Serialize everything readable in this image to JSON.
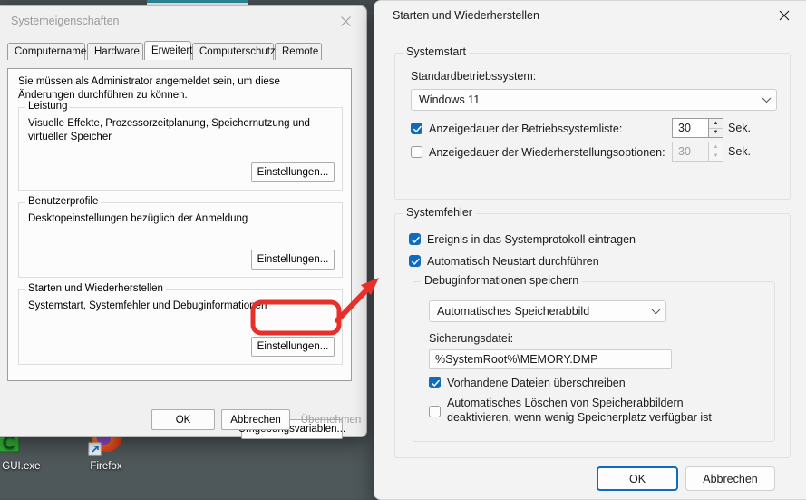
{
  "desktop": {
    "icons": [
      {
        "name": "te GUI.exe",
        "label": "te GUI.exe"
      },
      {
        "name": "firefox",
        "label": "Firefox"
      }
    ]
  },
  "sysprops": {
    "title": "Systemeigenschaften",
    "close_icon": "close-icon",
    "tabs": [
      {
        "label": "Computername",
        "active": false
      },
      {
        "label": "Hardware",
        "active": false
      },
      {
        "label": "Erweitert",
        "active": true
      },
      {
        "label": "Computerschutz",
        "active": false
      },
      {
        "label": "Remote",
        "active": false
      }
    ],
    "intro": "Sie müssen als Administrator angemeldet sein, um diese Änderungen durchführen zu können.",
    "groups": [
      {
        "legend": "Leistung",
        "text": "Visuelle Effekte, Prozessorzeitplanung, Speichernutzung und virtueller Speicher",
        "button": "Einstellungen..."
      },
      {
        "legend": "Benutzerprofile",
        "text": "Desktopeinstellungen bezüglich der Anmeldung",
        "button": "Einstellungen..."
      },
      {
        "legend": "Starten und Wiederherstellen",
        "text": "Systemstart, Systemfehler und Debuginformationen",
        "button": "Einstellungen..."
      }
    ],
    "env_button": "Umgebungsvariablen...",
    "footer": {
      "ok": "OK",
      "cancel": "Abbrechen",
      "apply": "Übernehmen"
    }
  },
  "startrec": {
    "title": "Starten und Wiederherstellen",
    "close_icon": "close-icon",
    "systemstart": {
      "legend": "Systemstart",
      "default_os_label": "Standardbetriebssystem:",
      "default_os_value": "Windows 11",
      "os_list_timeout": {
        "label": "Anzeigedauer der Betriebssystemliste:",
        "checked": true,
        "value": "30",
        "unit": "Sek."
      },
      "recovery_timeout": {
        "label": "Anzeigedauer der Wiederherstellungsoptionen:",
        "checked": false,
        "value": "30",
        "unit": "Sek."
      }
    },
    "systemfehler": {
      "legend": "Systemfehler",
      "log_event": {
        "label": "Ereignis in das Systemprotokoll eintragen",
        "checked": true
      },
      "auto_restart": {
        "label": "Automatisch Neustart durchführen",
        "checked": true
      },
      "debug": {
        "legend": "Debuginformationen speichern",
        "dump_type": "Automatisches Speicherabbild",
        "dumpfile_label": "Sicherungsdatei:",
        "dumpfile_value": "%SystemRoot%\\MEMORY.DMP",
        "overwrite": {
          "label": "Vorhandene Dateien überschreiben",
          "checked": true
        },
        "disable_autodelete": {
          "label": "Automatisches Löschen von Speicherabbildern deaktivieren, wenn wenig Speicherplatz verfügbar ist",
          "checked": false
        }
      }
    },
    "footer": {
      "ok": "OK",
      "cancel": "Abbrechen"
    }
  },
  "annotation": {
    "color": "#e8302a",
    "highlight_target": "Einstellungen...",
    "shapes": [
      "highlight-rect",
      "arrow"
    ]
  }
}
